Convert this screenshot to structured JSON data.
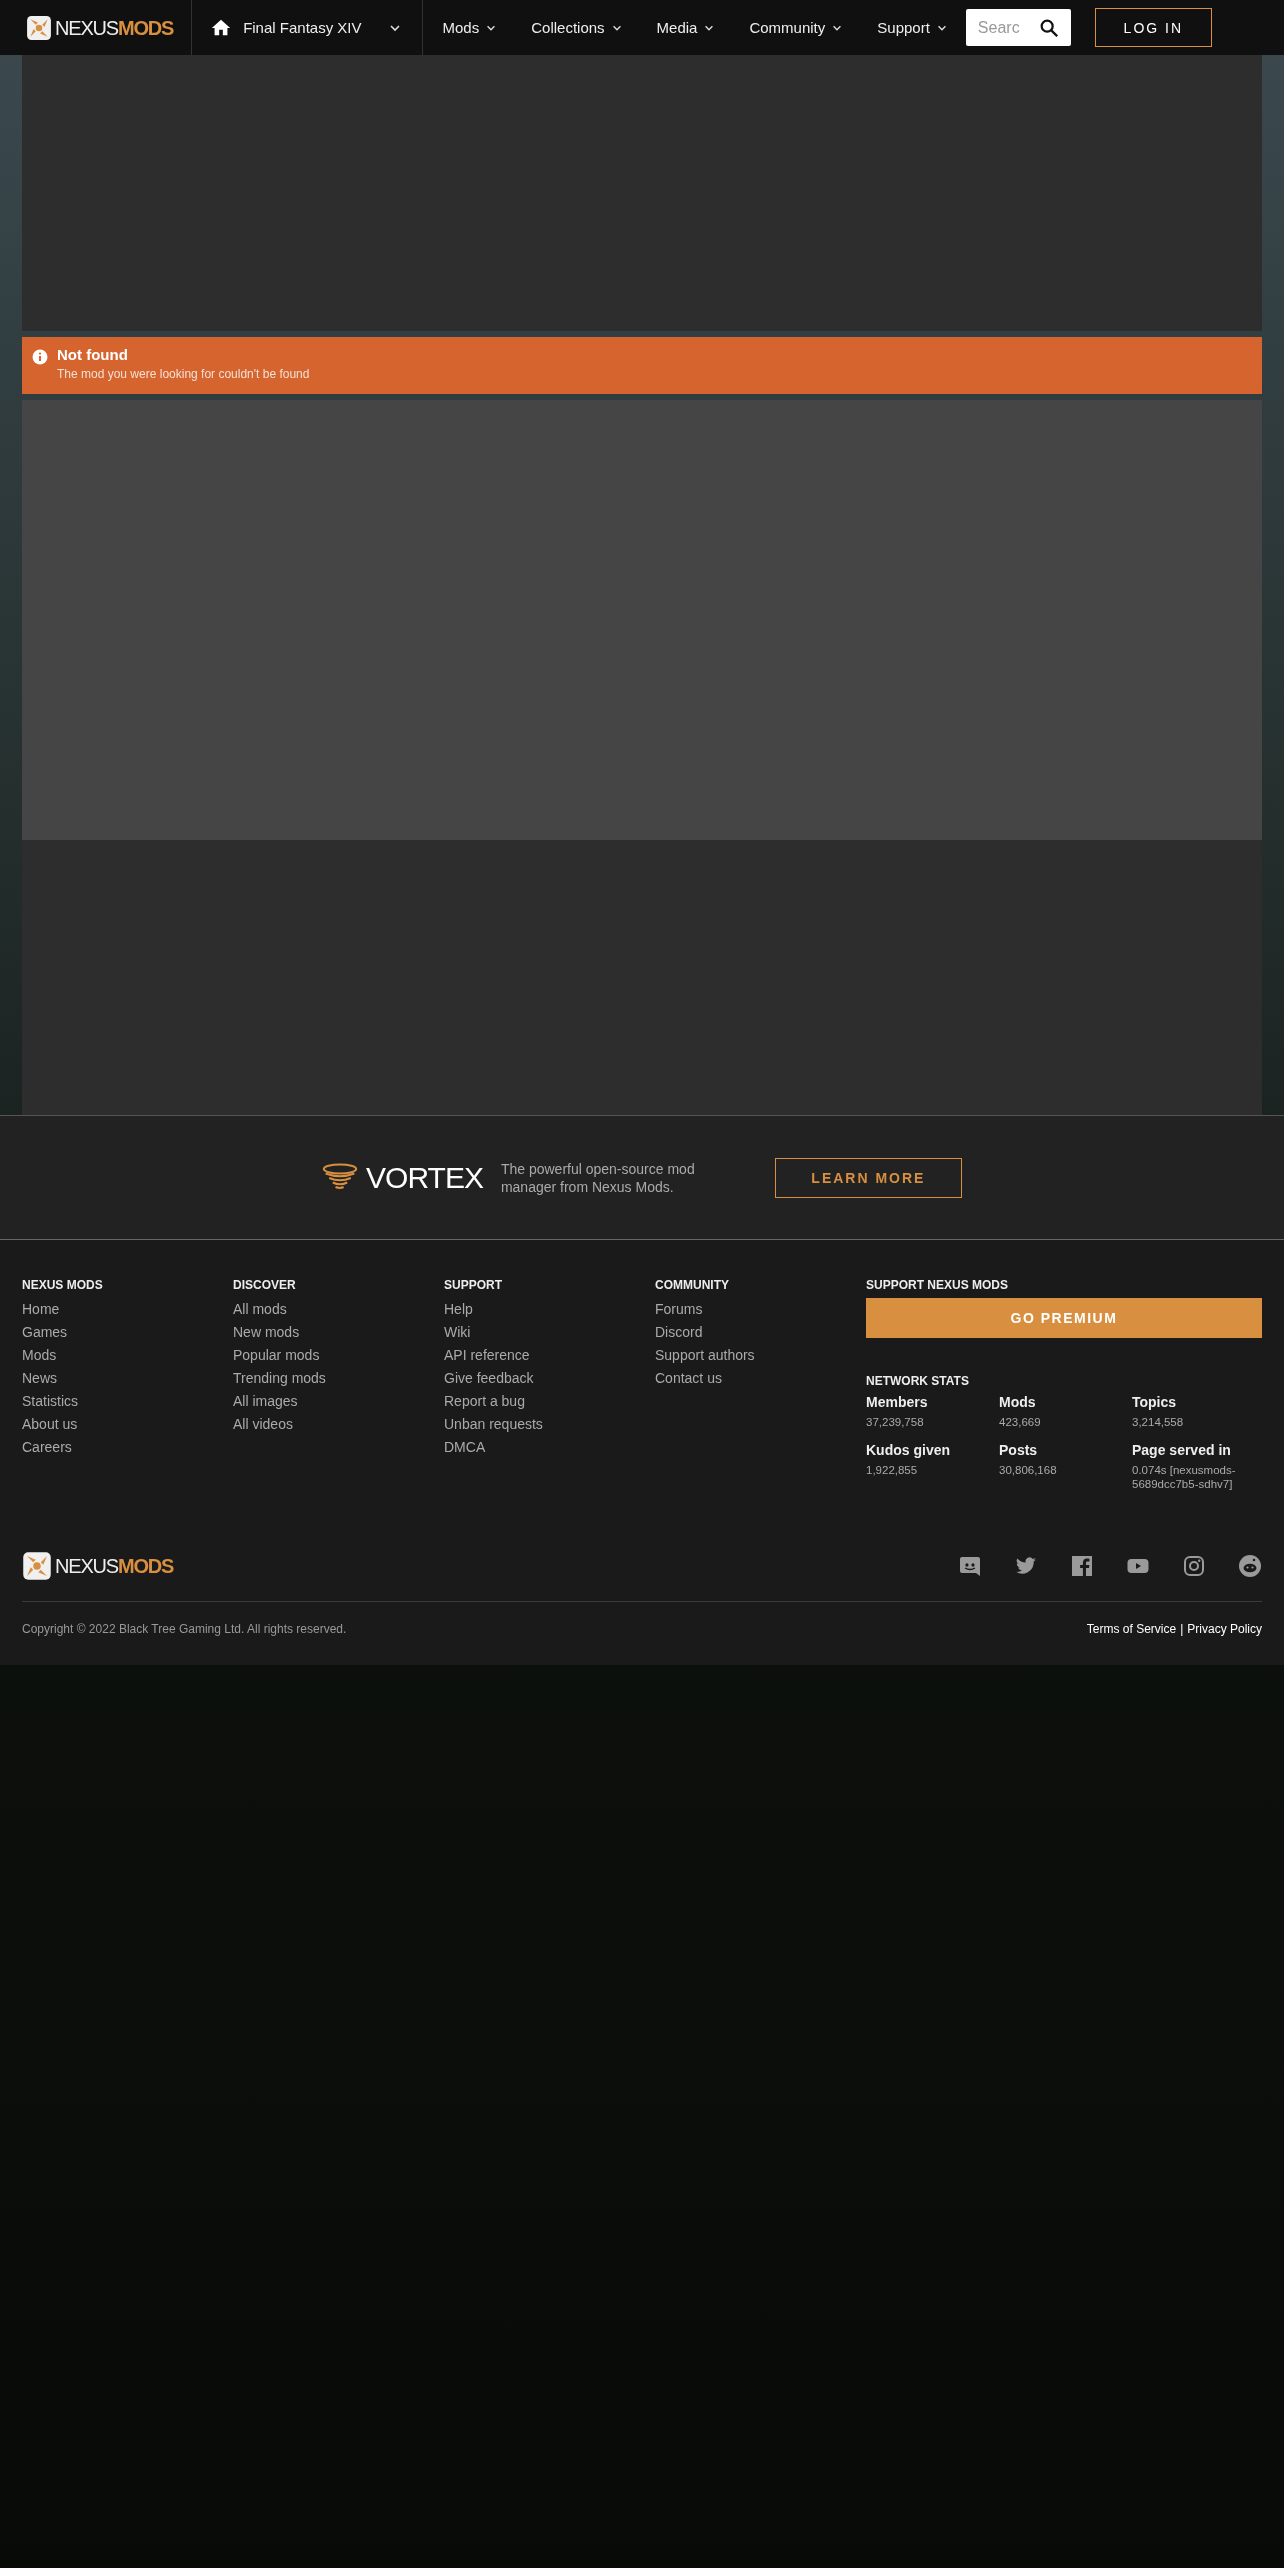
{
  "header": {
    "logo": {
      "word_1": "NEXUS",
      "word_2": "MODS"
    },
    "game": {
      "label": "Final Fantasy XIV"
    },
    "nav": [
      {
        "label": "Mods"
      },
      {
        "label": "Collections"
      },
      {
        "label": "Media"
      },
      {
        "label": "Community"
      },
      {
        "label": "Support"
      }
    ],
    "search": {
      "placeholder": "Searc"
    },
    "login": "LOG IN"
  },
  "alert": {
    "title": "Not found",
    "message": "The mod you were looking for couldn't be found"
  },
  "vortex": {
    "name": "VORTEX",
    "tagline": "The powerful open-source mod manager from Nexus Mods.",
    "button": "LEARN MORE"
  },
  "footer": {
    "columns": [
      {
        "heading": "NEXUS MODS",
        "links": [
          "Home",
          "Games",
          "Mods",
          "News",
          "Statistics",
          "About us",
          "Careers"
        ]
      },
      {
        "heading": "DISCOVER",
        "links": [
          "All mods",
          "New mods",
          "Popular mods",
          "Trending mods",
          "All images",
          "All videos"
        ]
      },
      {
        "heading": "SUPPORT",
        "links": [
          "Help",
          "Wiki",
          "API reference",
          "Give feedback",
          "Report a bug",
          "Unban requests",
          "DMCA"
        ]
      },
      {
        "heading": "COMMUNITY",
        "links": [
          "Forums",
          "Discord",
          "Support authors",
          "Contact us"
        ]
      }
    ],
    "support": {
      "heading": "SUPPORT NEXUS MODS",
      "button": "GO PREMIUM"
    },
    "stats": {
      "heading": "NETWORK STATS",
      "items": [
        {
          "label": "Members",
          "value": "37,239,758"
        },
        {
          "label": "Mods",
          "value": "423,669"
        },
        {
          "label": "Topics",
          "value": "3,214,558"
        },
        {
          "label": "Kudos given",
          "value": "1,922,855"
        },
        {
          "label": "Posts",
          "value": "30,806,168"
        },
        {
          "label": "Page served in",
          "value": "0.074s [nexusmods-5689dcc7b5-sdhv7]"
        }
      ]
    },
    "logo": {
      "word_1": "NEXUS",
      "word_2": "MODS"
    },
    "social": [
      {
        "kind": "discord"
      },
      {
        "kind": "twitter"
      },
      {
        "kind": "facebook"
      },
      {
        "kind": "youtube"
      },
      {
        "kind": "instagram"
      },
      {
        "kind": "reddit"
      }
    ],
    "copyright": "Copyright © 2022 Black Tree Gaming Ltd. All rights reserved.",
    "legal": [
      {
        "label": "Terms of Service"
      },
      {
        "label": "Privacy Policy"
      }
    ],
    "legal_separator": "|"
  }
}
